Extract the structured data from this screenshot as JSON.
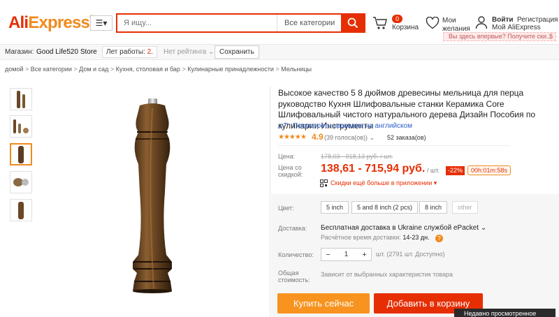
{
  "header": {
    "logo_part1": "Ali",
    "logo_part2": "Express",
    "logo_tm": "®",
    "menu_icon": "hamburger-icon",
    "search_placeholder": "Я ищу...",
    "search_category": "Все категории",
    "search_icon": "search-icon",
    "cart_count": "0",
    "cart_label": "Корзина",
    "wishlist_line1": "Мои",
    "wishlist_line2": "желания",
    "login_label": "Войти",
    "register_label": "Регистрация",
    "my_account_label": "Мой AliExpress",
    "promo_text": "Вы здесь впервые? Получите ски...",
    "promo_currency": "$"
  },
  "store": {
    "label": "Магазин:",
    "name": "Good Life520 Store",
    "years_label": "Лет работы:",
    "years_value": "2",
    "years_dot": ".",
    "rating_label": "Нет рейтинга",
    "save_label": "Сохранить"
  },
  "breadcrumb": [
    "домой",
    "Все категории",
    "Дом и сад",
    "Кухня, столовая и бар",
    "Кулинарные принадлежности",
    "Мельницы"
  ],
  "product": {
    "title": "Высокое качество 5 8 дюймов древесины мельница для перца руководство Кухня Шлифовальные станки Керамика Core Шлифовальный чистого натурального дерева Дизайн Пособия по кулинарии Инструменты",
    "translate_link": "Посмотреть название на английском",
    "stars": "★★★★★",
    "rating": "4.9",
    "votes": "(39 голоса(ов))",
    "orders": "52 заказа(ов)",
    "price_label": "Цена:",
    "old_price": "178,03 - 918,13 руб. / шт.",
    "discount_price_label_1": "Цена со",
    "discount_price_label_2": "скидкой:",
    "price": "138,61 - 715,94 руб.",
    "unit": "/ шт.",
    "discount": "-22%",
    "timer": "00h:01m:58s",
    "app_discount": "Скидки ещё больше в приложении",
    "color_label": "Цвет:",
    "color_options": [
      "5 inch",
      "5 and 8 inch (2 pcs)",
      "8 inch",
      "other"
    ],
    "shipping_label": "Доставка:",
    "shipping_text": "Бесплатная доставка в Ukraine службой ePacket",
    "shipping_time_label": "Расчётное время доставки:",
    "shipping_time": "14-23 дн.",
    "quantity_label": "Количество:",
    "quantity_value": "1",
    "quantity_minus": "−",
    "quantity_plus": "+",
    "quantity_info": "шт. (2791 шт. Доступно)",
    "total_label_1": "Общая",
    "total_label_2": "стоимость:",
    "total_text": "Зависит от выбранных характеристик товара",
    "buy_now": "Купить сейчас",
    "add_to_cart": "Добавить в корзину",
    "recently_viewed": "Недавно просмотренное"
  }
}
